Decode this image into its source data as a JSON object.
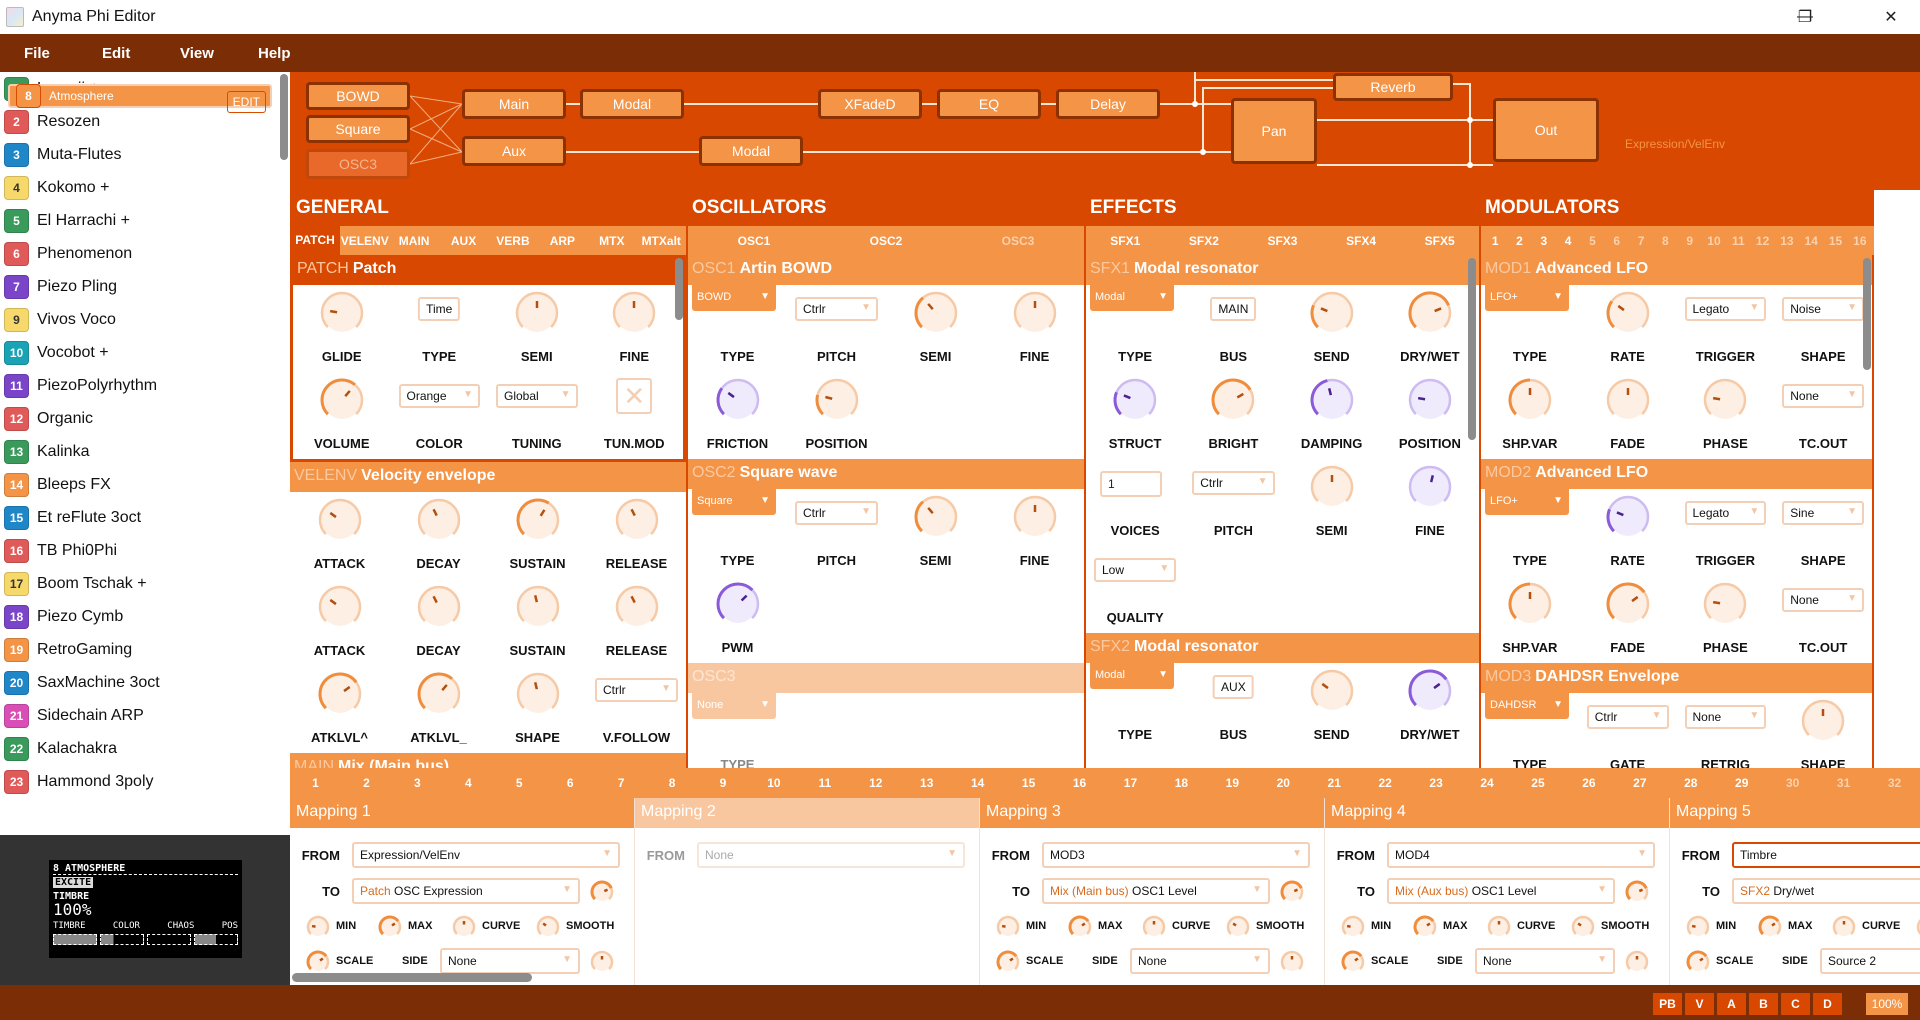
{
  "window": {
    "title": "Anyma Phi Editor",
    "minimize": "—",
    "maximize": "❐",
    "close": "✕"
  },
  "menu": [
    "File",
    "Edit",
    "View",
    "Help"
  ],
  "presets": [
    {
      "num": "1",
      "name": "Laraaji +",
      "color": "#3a9a5b"
    },
    {
      "num": "2",
      "name": "Resozen",
      "color": "#e05a5a"
    },
    {
      "num": "3",
      "name": "Muta-Flutes",
      "color": "#1f86c8"
    },
    {
      "num": "4",
      "name": "Kokomo +",
      "color": "#f7d86a"
    },
    {
      "num": "5",
      "name": "El Harrachi +",
      "color": "#3a9a5b"
    },
    {
      "num": "6",
      "name": "Phenomenon",
      "color": "#e05a5a"
    },
    {
      "num": "7",
      "name": "Piezo Pling",
      "color": "#7a45c8"
    },
    {
      "num": "8",
      "name": "Atmosphere",
      "color": "#f39447",
      "selected": true,
      "edit": "EDIT"
    },
    {
      "num": "9",
      "name": "Vivos Voco",
      "color": "#f7d86a"
    },
    {
      "num": "10",
      "name": "Vocobot +",
      "color": "#19a3b5"
    },
    {
      "num": "11",
      "name": "PiezoPolyrhythm",
      "color": "#7a45c8"
    },
    {
      "num": "12",
      "name": "Organic",
      "color": "#e05a5a"
    },
    {
      "num": "13",
      "name": "Kalinka",
      "color": "#3a9a5b"
    },
    {
      "num": "14",
      "name": "Bleeps FX",
      "color": "#f39447"
    },
    {
      "num": "15",
      "name": "Et reFlute 3oct",
      "color": "#1f86c8"
    },
    {
      "num": "16",
      "name": "TB Phi0Phi",
      "color": "#e05a5a"
    },
    {
      "num": "17",
      "name": "Boom Tschak +",
      "color": "#f7d86a"
    },
    {
      "num": "18",
      "name": "Piezo Cymb",
      "color": "#7a45c8"
    },
    {
      "num": "19",
      "name": "RetroGaming",
      "color": "#f39447"
    },
    {
      "num": "20",
      "name": "SaxMachine 3oct",
      "color": "#1f86c8"
    },
    {
      "num": "21",
      "name": "Sidechain ARP",
      "color": "#d94fb5"
    },
    {
      "num": "22",
      "name": "Kalachakra",
      "color": "#3a9a5b"
    },
    {
      "num": "23",
      "name": "Hammond 3poly",
      "color": "#e05a5a"
    }
  ],
  "lcd": {
    "title": "8 ATMOSPHERE",
    "page": "EXCITE",
    "param": "TIMBRE",
    "value": "100%",
    "params": [
      "TIMBRE",
      "COLOR",
      "CHAOS",
      "POS"
    ],
    "levels": [
      1.0,
      0.3,
      0.0,
      0.5
    ]
  },
  "routing": {
    "sources": [
      "BOWD",
      "Square",
      "OSC3"
    ],
    "main": "Main",
    "main_fx": [
      "Modal",
      "XFadeD",
      "EQ",
      "Delay"
    ],
    "aux": "Aux",
    "aux_fx": "Modal",
    "reverb": "Reverb",
    "pan": "Pan",
    "out": "Out",
    "hint": "Expression/VelEnv"
  },
  "general": {
    "heading": "GENERAL",
    "tabs": [
      "PATCH",
      "VELENV",
      "MAIN",
      "AUX",
      "VERB",
      "ARP",
      "MTX",
      "MTXalt"
    ],
    "sections": [
      {
        "tag": "PATCH",
        "title": "Patch",
        "state": "hot",
        "controls": [
          {
            "type": "knob",
            "label": "GLIDE",
            "value": 0.2
          },
          {
            "type": "box",
            "label": "TYPE",
            "value": "Time"
          },
          {
            "type": "knob",
            "label": "SEMI",
            "value": 0.5
          },
          {
            "type": "knob",
            "label": "FINE",
            "value": 0.5
          },
          {
            "type": "knob",
            "label": "VOLUME",
            "value": 0.65,
            "active": true
          },
          {
            "type": "select",
            "label": "COLOR",
            "value": "Orange"
          },
          {
            "type": "select",
            "label": "TUNING",
            "value": "Global"
          },
          {
            "type": "check",
            "label": "TUN.MOD",
            "value": "✕"
          }
        ]
      },
      {
        "tag": "VELENV",
        "title": "Velocity envelope",
        "controls": [
          {
            "type": "knob",
            "label": "ATTACK",
            "value": 0.3
          },
          {
            "type": "knob",
            "label": "DECAY",
            "value": 0.4
          },
          {
            "type": "knob",
            "label": "SUSTAIN",
            "value": 0.62,
            "active": true
          },
          {
            "type": "knob",
            "label": "RELEASE",
            "value": 0.4
          },
          {
            "type": "knob",
            "label": "ATTACK",
            "value": 0.3
          },
          {
            "type": "knob",
            "label": "DECAY",
            "value": 0.4
          },
          {
            "type": "knob",
            "label": "SUSTAIN",
            "value": 0.45
          },
          {
            "type": "knob",
            "label": "RELEASE",
            "value": 0.4
          },
          {
            "type": "knob",
            "label": "ATKLVL^",
            "value": 0.7,
            "active": true
          },
          {
            "type": "knob",
            "label": "ATKLVL_",
            "value": 0.65,
            "active": true
          },
          {
            "type": "knob",
            "label": "SHAPE",
            "value": 0.45
          },
          {
            "type": "select",
            "label": "V.FOLLOW",
            "value": "Ctrlr"
          }
        ]
      },
      {
        "tag": "MAIN",
        "title": "Mix (Main bus)",
        "controls": []
      }
    ]
  },
  "oscillators": {
    "heading": "OSCILLATORS",
    "tabs": [
      "OSC1",
      "OSC2",
      "OSC3"
    ],
    "sections": [
      {
        "tag": "OSC1",
        "title": "Artin BOWD",
        "controls": [
          {
            "type": "primary",
            "label": "TYPE",
            "value": "BOWD"
          },
          {
            "type": "select",
            "label": "PITCH",
            "value": "Ctrlr"
          },
          {
            "type": "knob",
            "label": "SEMI",
            "value": 0.35,
            "active": true
          },
          {
            "type": "knob",
            "label": "FINE",
            "value": 0.5
          },
          {
            "type": "knob",
            "label": "FRICTION",
            "value": 0.3,
            "color": "purple",
            "active": true
          },
          {
            "type": "knob",
            "label": "POSITION",
            "value": 0.22,
            "active": true
          }
        ]
      },
      {
        "tag": "OSC2",
        "title": "Square wave",
        "controls": [
          {
            "type": "primary",
            "label": "TYPE",
            "value": "Square"
          },
          {
            "type": "select",
            "label": "PITCH",
            "value": "Ctrlr"
          },
          {
            "type": "knob",
            "label": "SEMI",
            "value": 0.35,
            "active": true
          },
          {
            "type": "knob",
            "label": "FINE",
            "value": 0.5
          },
          {
            "type": "knob",
            "label": "PWM",
            "value": 0.67,
            "color": "purple",
            "active": true
          }
        ]
      },
      {
        "tag": "OSC3",
        "title": "",
        "state": "off",
        "controls": [
          {
            "type": "primary",
            "label": "TYPE",
            "value": "None"
          }
        ]
      }
    ]
  },
  "effects": {
    "heading": "EFFECTS",
    "tabs": [
      "SFX1",
      "SFX2",
      "SFX3",
      "SFX4",
      "SFX5"
    ],
    "sections": [
      {
        "tag": "SFX1",
        "title": "Modal resonator",
        "controls": [
          {
            "type": "primary",
            "label": "TYPE",
            "value": "Modal"
          },
          {
            "type": "box",
            "label": "BUS",
            "value": "MAIN"
          },
          {
            "type": "knob",
            "label": "SEND",
            "value": 0.25,
            "active": true
          },
          {
            "type": "knob",
            "label": "DRY/WET",
            "value": 0.75,
            "active": true
          },
          {
            "type": "knob",
            "label": "STRUCT",
            "value": 0.25,
            "color": "purple",
            "active": true
          },
          {
            "type": "knob",
            "label": "BRIGHT",
            "value": 0.72,
            "active": true
          },
          {
            "type": "knob",
            "label": "DAMPING",
            "value": 0.45,
            "color": "purple",
            "active": true
          },
          {
            "type": "knob",
            "label": "POSITION",
            "value": 0.2,
            "color": "purple"
          },
          {
            "type": "input",
            "label": "VOICES",
            "value": "1"
          },
          {
            "type": "select",
            "label": "PITCH",
            "value": "Ctrlr"
          },
          {
            "type": "knob",
            "label": "SEMI",
            "value": 0.5
          },
          {
            "type": "knob",
            "label": "FINE",
            "value": 0.55,
            "color": "purple"
          },
          {
            "type": "select",
            "label": "QUALITY",
            "value": "Low"
          }
        ]
      },
      {
        "tag": "SFX2",
        "title": "Modal resonator",
        "controls": [
          {
            "type": "primary",
            "label": "TYPE",
            "value": "Modal"
          },
          {
            "type": "box",
            "label": "BUS",
            "value": "AUX"
          },
          {
            "type": "knob",
            "label": "SEND",
            "value": 0.3
          },
          {
            "type": "knob",
            "label": "DRY/WET",
            "value": 0.7,
            "color": "purple",
            "active": true
          }
        ]
      }
    ]
  },
  "modulators": {
    "heading": "MODULATORS",
    "tabs": [
      "1",
      "2",
      "3",
      "4",
      "5",
      "6",
      "7",
      "8",
      "9",
      "10",
      "11",
      "12",
      "13",
      "14",
      "15",
      "16"
    ],
    "active_tabs": 4,
    "sections": [
      {
        "tag": "MOD1",
        "title": "Advanced LFO",
        "controls": [
          {
            "type": "primary",
            "label": "TYPE",
            "value": "LFO+"
          },
          {
            "type": "knob",
            "label": "RATE",
            "value": 0.3,
            "active": true
          },
          {
            "type": "select",
            "label": "TRIGGER",
            "value": "Legato"
          },
          {
            "type": "select",
            "label": "SHAPE",
            "value": "Noise"
          },
          {
            "type": "knob",
            "label": "SHP.VAR",
            "value": 0.5,
            "active": true
          },
          {
            "type": "knob",
            "label": "FADE",
            "value": 0.5
          },
          {
            "type": "knob",
            "label": "PHASE",
            "value": 0.2
          },
          {
            "type": "select",
            "label": "TC.OUT",
            "value": "None"
          }
        ]
      },
      {
        "tag": "MOD2",
        "title": "Advanced LFO",
        "controls": [
          {
            "type": "primary",
            "label": "TYPE",
            "value": "LFO+"
          },
          {
            "type": "knob",
            "label": "RATE",
            "value": 0.25,
            "color": "purple",
            "active": true
          },
          {
            "type": "select",
            "label": "TRIGGER",
            "value": "Legato"
          },
          {
            "type": "select",
            "label": "SHAPE",
            "value": "Sine"
          },
          {
            "type": "knob",
            "label": "SHP.VAR",
            "value": 0.5,
            "active": true
          },
          {
            "type": "knob",
            "label": "FADE",
            "value": 0.7,
            "active": true
          },
          {
            "type": "knob",
            "label": "PHASE",
            "value": 0.2
          },
          {
            "type": "select",
            "label": "TC.OUT",
            "value": "None"
          }
        ]
      },
      {
        "tag": "MOD3",
        "title": "DAHDSR Envelope",
        "controls": [
          {
            "type": "primary",
            "label": "TYPE",
            "value": "DAHDSR"
          },
          {
            "type": "select",
            "label": "GATE",
            "value": "Ctrlr"
          },
          {
            "type": "select",
            "label": "RETRIG",
            "value": "None"
          },
          {
            "type": "knob",
            "label": "SHAPE",
            "value": 0.5
          }
        ]
      }
    ]
  },
  "mapping_numbers": [
    "1",
    "2",
    "3",
    "4",
    "5",
    "6",
    "7",
    "8",
    "9",
    "10",
    "11",
    "12",
    "13",
    "14",
    "15",
    "16",
    "17",
    "18",
    "19",
    "20",
    "21",
    "22",
    "23",
    "24",
    "25",
    "26",
    "27",
    "28",
    "29",
    "30",
    "31",
    "32"
  ],
  "mapping_numbers_active": 29,
  "mapping_labels": {
    "from": "FROM",
    "to": "TO",
    "min": "MIN",
    "max": "MAX",
    "curve": "CURVE",
    "smooth": "SMOOTH",
    "scale": "SCALE",
    "side": "SIDE"
  },
  "mappings": [
    {
      "title": "Mapping 1",
      "from": "Expression/VelEnv",
      "to_prefix": "Patch",
      "to": "OSC Expression",
      "side": "None",
      "amount": 0.75,
      "min": 0.2,
      "max": 0.7,
      "curve": 0.5,
      "smooth": 0.3,
      "scale": 0.7,
      "side_amount": 0.5
    },
    {
      "title": "Mapping 2",
      "disabled": true,
      "from": "None"
    },
    {
      "title": "Mapping 3",
      "from": "MOD3",
      "to_prefix": "Mix (Main bus)",
      "to": "OSC1 Level",
      "side": "None",
      "amount": 0.75,
      "min": 0.2,
      "max": 0.7,
      "curve": 0.5,
      "smooth": 0.3,
      "scale": 0.7,
      "side_amount": 0.5
    },
    {
      "title": "Mapping 4",
      "from": "MOD4",
      "to_prefix": "Mix (Aux bus)",
      "to": "OSC1 Level",
      "side": "None",
      "amount": 0.75,
      "min": 0.2,
      "max": 0.7,
      "curve": 0.5,
      "smooth": 0.3,
      "scale": 0.7,
      "side_amount": 0.5
    },
    {
      "title": "Mapping 5",
      "from": "Timbre",
      "focused": true,
      "to_prefix": "SFX2",
      "to": "Dry/wet",
      "side": "Source 2",
      "amount": 0.75,
      "min": 0.2,
      "max": 0.7,
      "curve": 0.5,
      "smooth": 0.3,
      "scale": 0.7,
      "side_amount": 0.5
    }
  ],
  "status": {
    "buttons": [
      "PB",
      "V",
      "A",
      "B",
      "C",
      "D"
    ],
    "zoom": "100%"
  },
  "colors": {
    "brown": "#7b2d05",
    "accent": "#d84800",
    "orange": "#f39447",
    "pale": "#f8c7a0",
    "purple": "#8a5ad8"
  }
}
